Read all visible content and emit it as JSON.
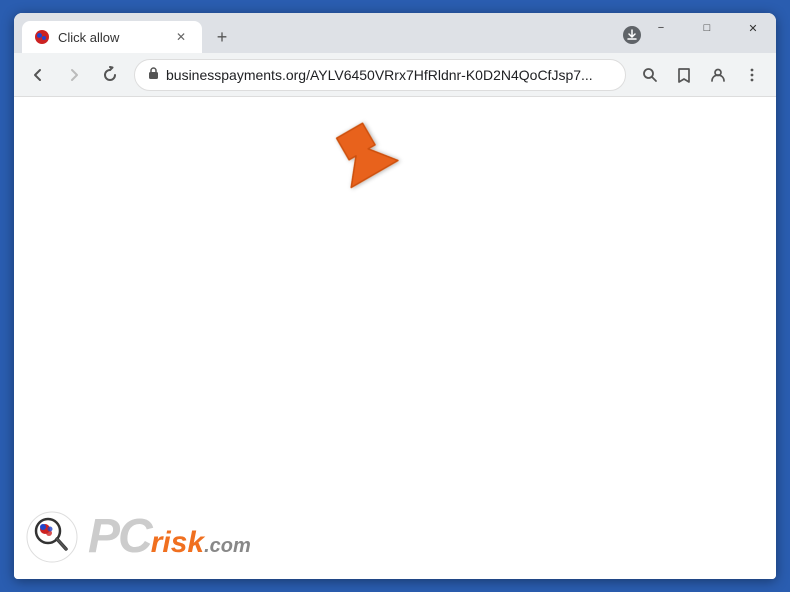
{
  "window": {
    "title": "Click allow",
    "controls": {
      "minimize": "−",
      "maximize": "□",
      "close": "✕"
    }
  },
  "tabs": [
    {
      "title": "Click allow",
      "active": true,
      "favicon": "red-circle"
    }
  ],
  "nav": {
    "back_disabled": false,
    "forward_disabled": true,
    "reload": "×",
    "url_display": "businesspayments.org/AYLV6450VRrx7HfRldnr-K0D2N4QoCfJsp7...",
    "url_bold_part": "businesspayments.org",
    "url_rest": "/AYLV6450VRrx7HfRldnr-K0D2N4QoCfJsp7..."
  },
  "actions": {
    "search": "🔍",
    "bookmark": "☆",
    "profile": "👤",
    "menu": "⋮"
  },
  "new_tab_label": "+",
  "download_icon": "⬇",
  "watermark": {
    "pc": "PC",
    "risk": "risk",
    "dotcom": ".com"
  }
}
